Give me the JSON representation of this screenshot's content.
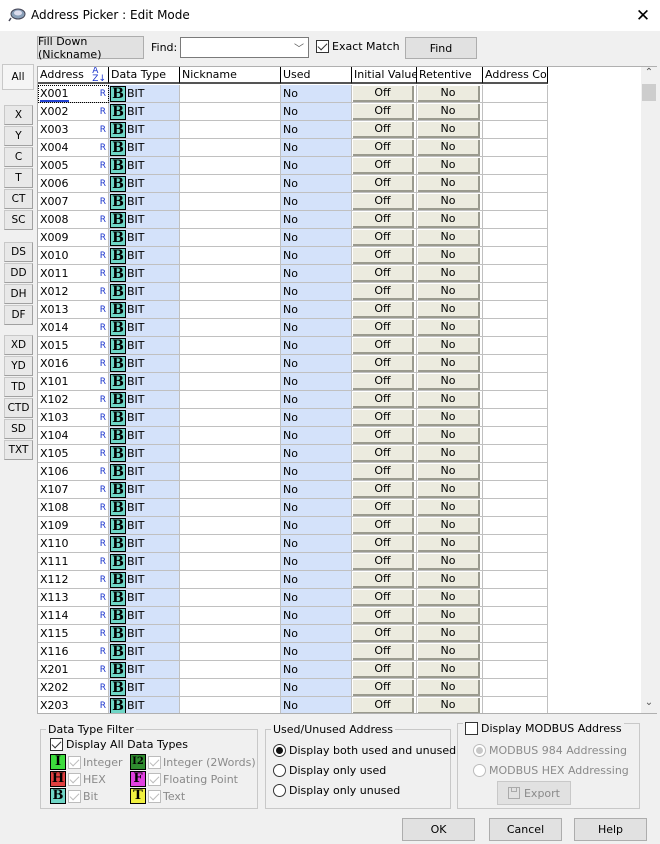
{
  "window": {
    "title": "Address Picker : Edit Mode",
    "close_icon": "close-icon"
  },
  "toolbar": {
    "fill_down_label": "Fill Down (Nickname)",
    "find_label": "Find:",
    "find_value": "",
    "exact_match_label": "Exact Match",
    "exact_match_checked": true,
    "find_button_label": "Find"
  },
  "side_tabs": [
    "All",
    "X",
    "Y",
    "C",
    "T",
    "CT",
    "SC",
    "DS",
    "DD",
    "DH",
    "DF",
    "XD",
    "YD",
    "TD",
    "CTD",
    "SD",
    "TXT"
  ],
  "active_side_tab": "All",
  "table": {
    "columns": [
      "Address",
      "Data Type",
      "Nickname",
      "Used",
      "Initial Value",
      "Retentive",
      "Address Com"
    ],
    "sort_icon": "sort-az-icon",
    "rows": [
      {
        "address": "X001",
        "flag": "R",
        "type_icon": "B",
        "type": "BIT",
        "nickname": "",
        "used": "No",
        "initial": "Off",
        "retentive": "No",
        "comment": ""
      },
      {
        "address": "X002",
        "flag": "R",
        "type_icon": "B",
        "type": "BIT",
        "nickname": "",
        "used": "No",
        "initial": "Off",
        "retentive": "No",
        "comment": ""
      },
      {
        "address": "X003",
        "flag": "R",
        "type_icon": "B",
        "type": "BIT",
        "nickname": "",
        "used": "No",
        "initial": "Off",
        "retentive": "No",
        "comment": ""
      },
      {
        "address": "X004",
        "flag": "R",
        "type_icon": "B",
        "type": "BIT",
        "nickname": "",
        "used": "No",
        "initial": "Off",
        "retentive": "No",
        "comment": ""
      },
      {
        "address": "X005",
        "flag": "R",
        "type_icon": "B",
        "type": "BIT",
        "nickname": "",
        "used": "No",
        "initial": "Off",
        "retentive": "No",
        "comment": ""
      },
      {
        "address": "X006",
        "flag": "R",
        "type_icon": "B",
        "type": "BIT",
        "nickname": "",
        "used": "No",
        "initial": "Off",
        "retentive": "No",
        "comment": ""
      },
      {
        "address": "X007",
        "flag": "R",
        "type_icon": "B",
        "type": "BIT",
        "nickname": "",
        "used": "No",
        "initial": "Off",
        "retentive": "No",
        "comment": ""
      },
      {
        "address": "X008",
        "flag": "R",
        "type_icon": "B",
        "type": "BIT",
        "nickname": "",
        "used": "No",
        "initial": "Off",
        "retentive": "No",
        "comment": ""
      },
      {
        "address": "X009",
        "flag": "R",
        "type_icon": "B",
        "type": "BIT",
        "nickname": "",
        "used": "No",
        "initial": "Off",
        "retentive": "No",
        "comment": ""
      },
      {
        "address": "X010",
        "flag": "R",
        "type_icon": "B",
        "type": "BIT",
        "nickname": "",
        "used": "No",
        "initial": "Off",
        "retentive": "No",
        "comment": ""
      },
      {
        "address": "X011",
        "flag": "R",
        "type_icon": "B",
        "type": "BIT",
        "nickname": "",
        "used": "No",
        "initial": "Off",
        "retentive": "No",
        "comment": ""
      },
      {
        "address": "X012",
        "flag": "R",
        "type_icon": "B",
        "type": "BIT",
        "nickname": "",
        "used": "No",
        "initial": "Off",
        "retentive": "No",
        "comment": ""
      },
      {
        "address": "X013",
        "flag": "R",
        "type_icon": "B",
        "type": "BIT",
        "nickname": "",
        "used": "No",
        "initial": "Off",
        "retentive": "No",
        "comment": ""
      },
      {
        "address": "X014",
        "flag": "R",
        "type_icon": "B",
        "type": "BIT",
        "nickname": "",
        "used": "No",
        "initial": "Off",
        "retentive": "No",
        "comment": ""
      },
      {
        "address": "X015",
        "flag": "R",
        "type_icon": "B",
        "type": "BIT",
        "nickname": "",
        "used": "No",
        "initial": "Off",
        "retentive": "No",
        "comment": ""
      },
      {
        "address": "X016",
        "flag": "R",
        "type_icon": "B",
        "type": "BIT",
        "nickname": "",
        "used": "No",
        "initial": "Off",
        "retentive": "No",
        "comment": ""
      },
      {
        "address": "X101",
        "flag": "R",
        "type_icon": "B",
        "type": "BIT",
        "nickname": "",
        "used": "No",
        "initial": "Off",
        "retentive": "No",
        "comment": ""
      },
      {
        "address": "X102",
        "flag": "R",
        "type_icon": "B",
        "type": "BIT",
        "nickname": "",
        "used": "No",
        "initial": "Off",
        "retentive": "No",
        "comment": ""
      },
      {
        "address": "X103",
        "flag": "R",
        "type_icon": "B",
        "type": "BIT",
        "nickname": "",
        "used": "No",
        "initial": "Off",
        "retentive": "No",
        "comment": ""
      },
      {
        "address": "X104",
        "flag": "R",
        "type_icon": "B",
        "type": "BIT",
        "nickname": "",
        "used": "No",
        "initial": "Off",
        "retentive": "No",
        "comment": ""
      },
      {
        "address": "X105",
        "flag": "R",
        "type_icon": "B",
        "type": "BIT",
        "nickname": "",
        "used": "No",
        "initial": "Off",
        "retentive": "No",
        "comment": ""
      },
      {
        "address": "X106",
        "flag": "R",
        "type_icon": "B",
        "type": "BIT",
        "nickname": "",
        "used": "No",
        "initial": "Off",
        "retentive": "No",
        "comment": ""
      },
      {
        "address": "X107",
        "flag": "R",
        "type_icon": "B",
        "type": "BIT",
        "nickname": "",
        "used": "No",
        "initial": "Off",
        "retentive": "No",
        "comment": ""
      },
      {
        "address": "X108",
        "flag": "R",
        "type_icon": "B",
        "type": "BIT",
        "nickname": "",
        "used": "No",
        "initial": "Off",
        "retentive": "No",
        "comment": ""
      },
      {
        "address": "X109",
        "flag": "R",
        "type_icon": "B",
        "type": "BIT",
        "nickname": "",
        "used": "No",
        "initial": "Off",
        "retentive": "No",
        "comment": ""
      },
      {
        "address": "X110",
        "flag": "R",
        "type_icon": "B",
        "type": "BIT",
        "nickname": "",
        "used": "No",
        "initial": "Off",
        "retentive": "No",
        "comment": ""
      },
      {
        "address": "X111",
        "flag": "R",
        "type_icon": "B",
        "type": "BIT",
        "nickname": "",
        "used": "No",
        "initial": "Off",
        "retentive": "No",
        "comment": ""
      },
      {
        "address": "X112",
        "flag": "R",
        "type_icon": "B",
        "type": "BIT",
        "nickname": "",
        "used": "No",
        "initial": "Off",
        "retentive": "No",
        "comment": ""
      },
      {
        "address": "X113",
        "flag": "R",
        "type_icon": "B",
        "type": "BIT",
        "nickname": "",
        "used": "No",
        "initial": "Off",
        "retentive": "No",
        "comment": ""
      },
      {
        "address": "X114",
        "flag": "R",
        "type_icon": "B",
        "type": "BIT",
        "nickname": "",
        "used": "No",
        "initial": "Off",
        "retentive": "No",
        "comment": ""
      },
      {
        "address": "X115",
        "flag": "R",
        "type_icon": "B",
        "type": "BIT",
        "nickname": "",
        "used": "No",
        "initial": "Off",
        "retentive": "No",
        "comment": ""
      },
      {
        "address": "X116",
        "flag": "R",
        "type_icon": "B",
        "type": "BIT",
        "nickname": "",
        "used": "No",
        "initial": "Off",
        "retentive": "No",
        "comment": ""
      },
      {
        "address": "X201",
        "flag": "R",
        "type_icon": "B",
        "type": "BIT",
        "nickname": "",
        "used": "No",
        "initial": "Off",
        "retentive": "No",
        "comment": ""
      },
      {
        "address": "X202",
        "flag": "R",
        "type_icon": "B",
        "type": "BIT",
        "nickname": "",
        "used": "No",
        "initial": "Off",
        "retentive": "No",
        "comment": ""
      },
      {
        "address": "X203",
        "flag": "R",
        "type_icon": "B",
        "type": "BIT",
        "nickname": "",
        "used": "No",
        "initial": "Off",
        "retentive": "No",
        "comment": ""
      }
    ]
  },
  "data_type_filter": {
    "legend": "Data Type Filter",
    "display_all_label": "Display All Data Types",
    "display_all_checked": true,
    "types": [
      {
        "icon": "I",
        "label": "Integer",
        "color": "#3ddc3d",
        "checked": true
      },
      {
        "icon": "I2",
        "label": "Integer (2Words)",
        "color": "#2e8b2e",
        "checked": true
      },
      {
        "icon": "H",
        "label": "HEX",
        "color": "#e04040",
        "checked": true
      },
      {
        "icon": "F",
        "label": "Floating Point",
        "color": "#e040e0",
        "checked": true
      },
      {
        "icon": "B",
        "label": "Bit",
        "color": "#6fd6c6",
        "checked": true
      },
      {
        "icon": "T",
        "label": "Text",
        "color": "#f0f040",
        "checked": true
      }
    ]
  },
  "used_unused": {
    "legend": "Used/Unused Address",
    "options": [
      "Display both used and unused",
      "Display only used",
      "Display only unused"
    ],
    "selected": 0
  },
  "modbus": {
    "legend": "Display MODBUS Address",
    "checked": false,
    "options": [
      "MODBUS 984 Addressing",
      "MODBUS HEX Addressing"
    ],
    "selected": 0,
    "export_label": "Export"
  },
  "footer": {
    "ok_label": "OK",
    "cancel_label": "Cancel",
    "help_label": "Help"
  }
}
